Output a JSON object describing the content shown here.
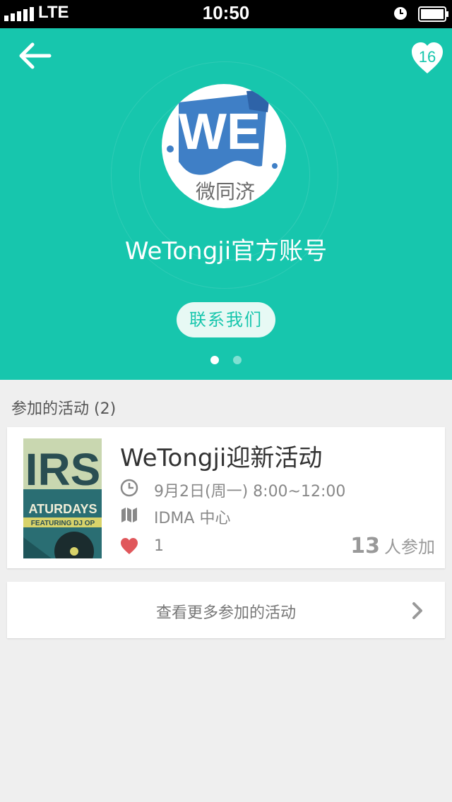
{
  "status_bar": {
    "carrier": "LTE",
    "time": "10:50"
  },
  "header": {
    "like_count": "16",
    "account_name": "WeTongji官方账号",
    "contact_button": "联系我们",
    "page_indicator": {
      "count": 2,
      "active": 0
    }
  },
  "section": {
    "title": "参加的活动 (2)"
  },
  "event": {
    "title": "WeTongji迎新活动",
    "time": "9月2日(周一) 8:00~12:00",
    "location": "IDMA 中心",
    "likes": "1",
    "participants_count": "13",
    "participants_unit": "人参加",
    "thumbnail_text": {
      "big": "IRS",
      "line": "ATURDAYS",
      "banner": "FEATURING DJ OP"
    }
  },
  "more_button": {
    "label": "查看更多参加的活动"
  },
  "logo_text": {
    "we": "WE",
    "cn": "微同济"
  },
  "colors": {
    "accent": "#17c6ad",
    "logo_blue": "#3f7fc6",
    "heart": "#e0575b"
  },
  "icons": [
    "back-arrow-icon",
    "heart-icon",
    "clock-icon",
    "map-icon",
    "chevron-right-icon"
  ]
}
